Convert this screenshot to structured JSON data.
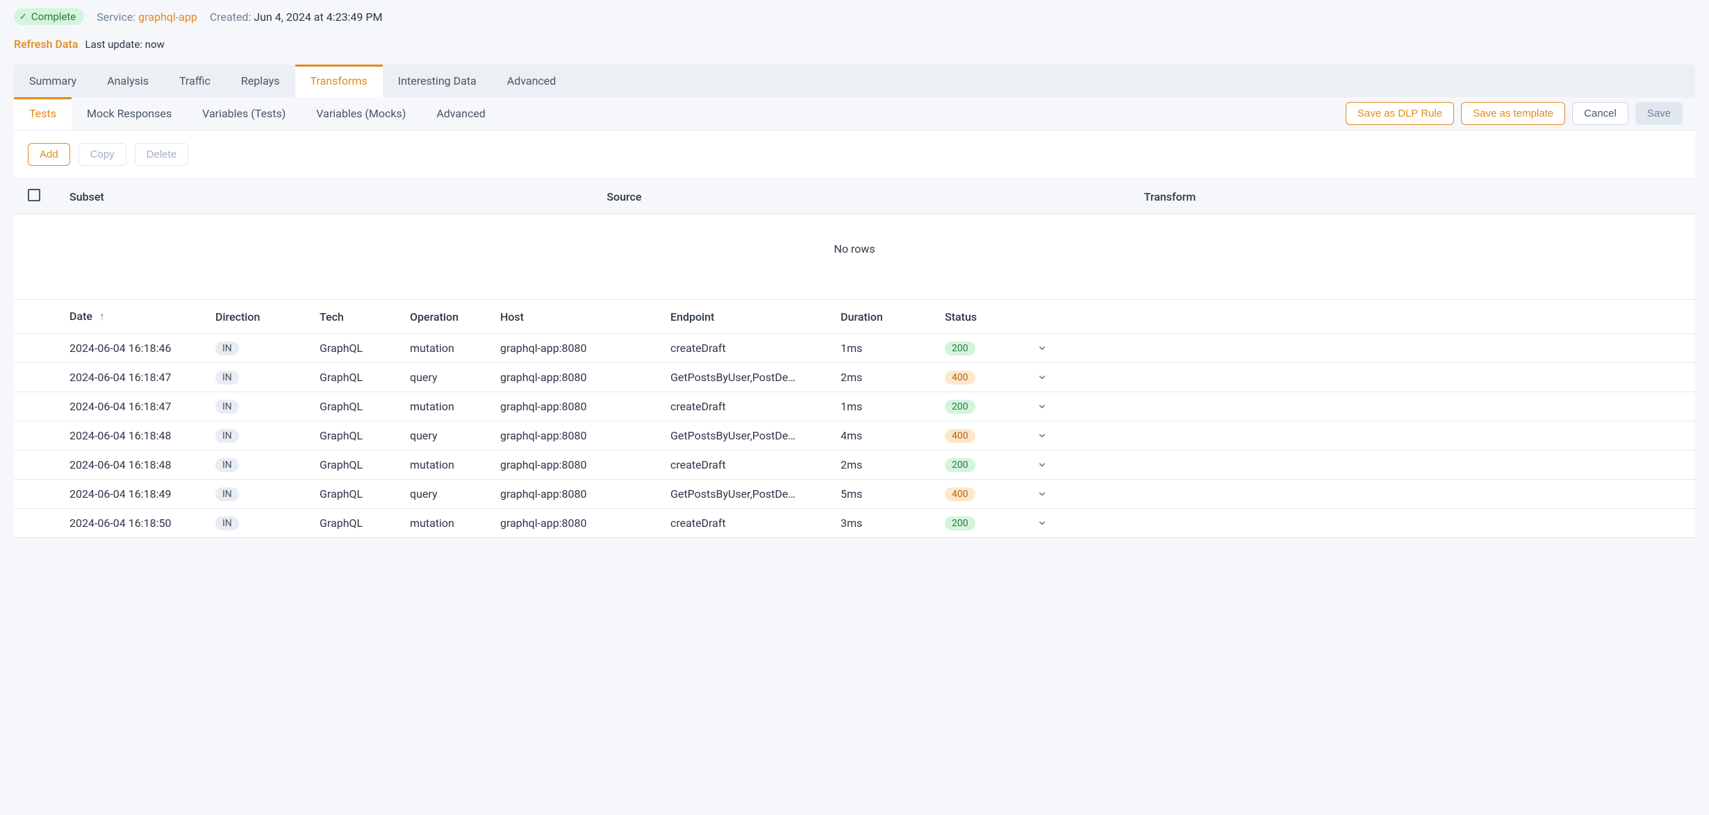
{
  "header": {
    "status_badge": "Complete",
    "service_label": "Service:",
    "service_value": "graphql-app",
    "created_label": "Created:",
    "created_value": "Jun 4, 2024 at 4:23:49 PM"
  },
  "refresh": {
    "link": "Refresh Data",
    "last_update_label": "Last update:",
    "last_update_value": "now"
  },
  "main_tabs": [
    "Summary",
    "Analysis",
    "Traffic",
    "Replays",
    "Transforms",
    "Interesting Data",
    "Advanced"
  ],
  "main_tab_active_index": 4,
  "sub_tabs": [
    "Tests",
    "Mock Responses",
    "Variables (Tests)",
    "Variables (Mocks)",
    "Advanced"
  ],
  "sub_tab_active_index": 0,
  "sub_actions": {
    "save_dlp": "Save as DLP Rule",
    "save_template": "Save as template",
    "cancel": "Cancel",
    "save": "Save"
  },
  "table_actions": {
    "add": "Add",
    "copy": "Copy",
    "delete": "Delete"
  },
  "transforms_table": {
    "columns": [
      "Subset",
      "Source",
      "Transform"
    ],
    "empty_text": "No rows"
  },
  "traffic_table": {
    "columns": {
      "date": "Date",
      "direction": "Direction",
      "tech": "Tech",
      "operation": "Operation",
      "host": "Host",
      "endpoint": "Endpoint",
      "duration": "Duration",
      "status": "Status"
    },
    "rows": [
      {
        "date": "2024-06-04 16:18:46",
        "direction": "IN",
        "tech": "GraphQL",
        "operation": "mutation",
        "host": "graphql-app:8080",
        "endpoint": "createDraft",
        "duration": "1ms",
        "status": "200"
      },
      {
        "date": "2024-06-04 16:18:47",
        "direction": "IN",
        "tech": "GraphQL",
        "operation": "query",
        "host": "graphql-app:8080",
        "endpoint": "GetPostsByUser,PostDe…",
        "duration": "2ms",
        "status": "400"
      },
      {
        "date": "2024-06-04 16:18:47",
        "direction": "IN",
        "tech": "GraphQL",
        "operation": "mutation",
        "host": "graphql-app:8080",
        "endpoint": "createDraft",
        "duration": "1ms",
        "status": "200"
      },
      {
        "date": "2024-06-04 16:18:48",
        "direction": "IN",
        "tech": "GraphQL",
        "operation": "query",
        "host": "graphql-app:8080",
        "endpoint": "GetPostsByUser,PostDe…",
        "duration": "4ms",
        "status": "400"
      },
      {
        "date": "2024-06-04 16:18:48",
        "direction": "IN",
        "tech": "GraphQL",
        "operation": "mutation",
        "host": "graphql-app:8080",
        "endpoint": "createDraft",
        "duration": "2ms",
        "status": "200"
      },
      {
        "date": "2024-06-04 16:18:49",
        "direction": "IN",
        "tech": "GraphQL",
        "operation": "query",
        "host": "graphql-app:8080",
        "endpoint": "GetPostsByUser,PostDe…",
        "duration": "5ms",
        "status": "400"
      },
      {
        "date": "2024-06-04 16:18:50",
        "direction": "IN",
        "tech": "GraphQL",
        "operation": "mutation",
        "host": "graphql-app:8080",
        "endpoint": "createDraft",
        "duration": "3ms",
        "status": "200"
      }
    ]
  }
}
